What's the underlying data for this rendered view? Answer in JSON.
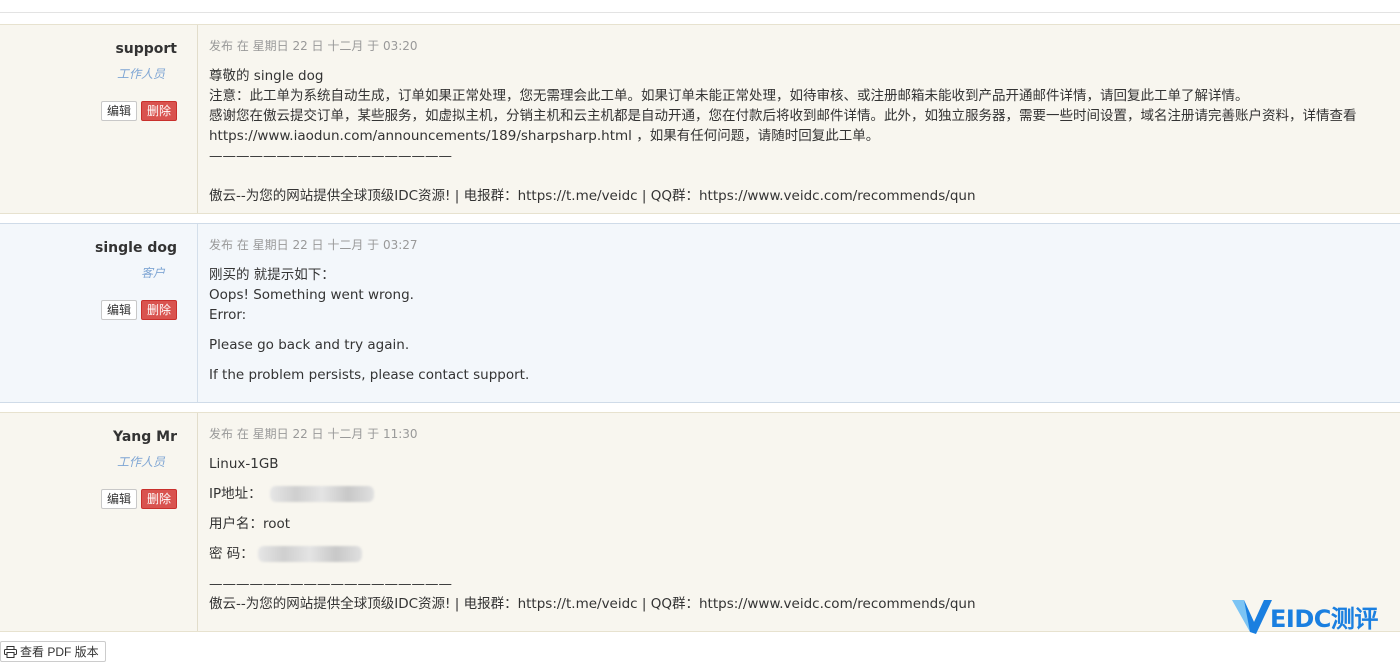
{
  "replies": [
    {
      "author": "support",
      "role": "工作人员",
      "edit_label": "编辑",
      "delete_label": "删除",
      "date": "发布 在 星期日 22 日 十二月 于 03:20",
      "lines": [
        "尊敬的 single dog",
        "注意：此工单为系统自动生成，订单如果正常处理，您无需理会此工单。如果订单未能正常处理，如待审核、或注册邮箱未能收到产品开通邮件详情，请回复此工单了解详情。",
        "感谢您在傲云提交订单，某些服务，如虚拟主机，分销主机和云主机都是自动开通，您在付款后将收到邮件详情。此外，如独立服务器，需要一些时间设置，域名注册请完善账户资料，详情查看",
        "https://www.iaodun.com/announcements/189/sharpsharp.html ，如果有任何问题，请随时回复此工单。",
        "——————————————————",
        "",
        "傲云--为您的网站提供全球顶级IDC资源! | 电报群：https://t.me/veidc | QQ群：https://www.veidc.com/recommends/qun"
      ]
    },
    {
      "author": "single dog",
      "role": "客户",
      "edit_label": "编辑",
      "delete_label": "删除",
      "date": "发布 在 星期日 22 日 十二月 于 03:27",
      "lines": [
        "刚买的 就提示如下：",
        "Oops! Something went wrong.",
        "Error:",
        "Please go back and try again.",
        "If the problem persists, please contact support."
      ]
    },
    {
      "author": "Yang Mr",
      "role": "工作人员",
      "edit_label": "编辑",
      "delete_label": "删除",
      "date": "发布 在 星期日 22 日 十二月 于 11:30",
      "lines": [
        "Linux-1GB",
        "IP地址：",
        "用户名：root",
        "密 码：",
        "——————————————————",
        "傲云--为您的网站提供全球顶级IDC资源! | 电报群：https://t.me/veidc | QQ群：https://www.veidc.com/recommends/qun"
      ]
    }
  ],
  "pdf_button_label": "查看 PDF 版本",
  "watermark": {
    "text": "EIDC测评",
    "icon": "veidc-v-logo-icon",
    "color": "#1a7fe0"
  },
  "colors": {
    "staff_bg": "#f8f6ef",
    "client_bg": "#f3f7fb",
    "delete_btn": "#d9534f",
    "role_text": "#7fa6d4"
  }
}
